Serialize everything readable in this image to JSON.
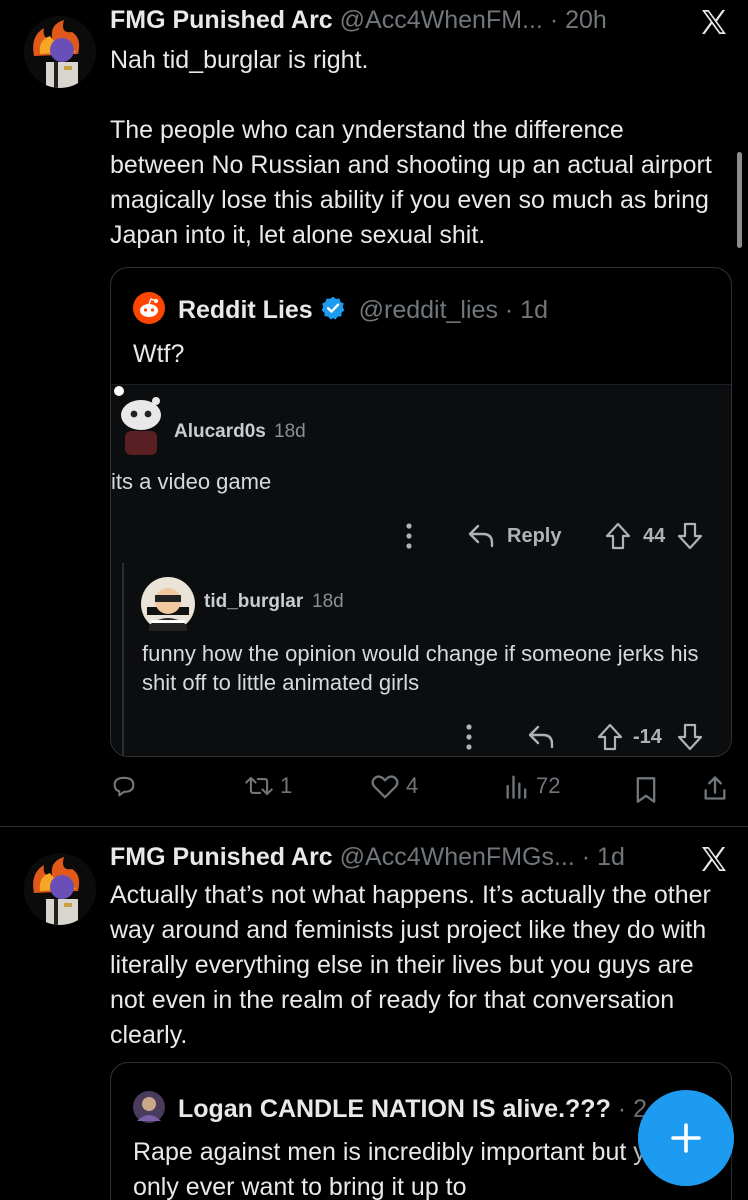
{
  "tweet1": {
    "display_name": "FMG Punished Arc",
    "handle": "@Acc4WhenFM...",
    "time": "· 20h",
    "text_line1": "Nah tid_burglar is right.",
    "text_para2": "The people who can ynderstand the difference between No Russian and shooting up an actual airport magically lose this ability if you even so much as bring Japan into it, let alone sexual shit.",
    "quote": {
      "display_name": "Reddit Lies",
      "handle": "@reddit_lies",
      "time": "· 1d",
      "text": "Wtf?",
      "reddit": {
        "comment1": {
          "username": "Alucard0s",
          "age": "18d",
          "text": "its a video game",
          "reply_label": "Reply",
          "score": "44"
        },
        "comment2": {
          "username": "tid_burglar",
          "age": "18d",
          "text": "funny how the opinion would change if someone jerks his shit off to little animated girls",
          "score": "-14"
        }
      }
    },
    "actions": {
      "replies": "",
      "reposts": "1",
      "likes": "4",
      "views": "72"
    }
  },
  "tweet2": {
    "display_name": "FMG Punished Arc",
    "handle": "@Acc4WhenFMGs...",
    "time": "· 1d",
    "text": "Actually that’s not what happens. It’s actually the other way around and feminists just project like they do with literally everything else in their lives but you guys are not even in the realm of ready for that conversation clearly.",
    "quote": {
      "display_name": "Logan CANDLE NATION IS alive.???",
      "time": "· 2",
      "text": "Rape against men is incredibly important but you lot only ever want to bring it up to"
    }
  },
  "icons": {
    "platform_logo": "x-logo-icon",
    "reddit": "reddit-logo-icon",
    "compose": "plus-icon"
  },
  "colors": {
    "accent": "#1d9bf0",
    "muted": "#71767b",
    "reddit_orange": "#ff4500"
  }
}
